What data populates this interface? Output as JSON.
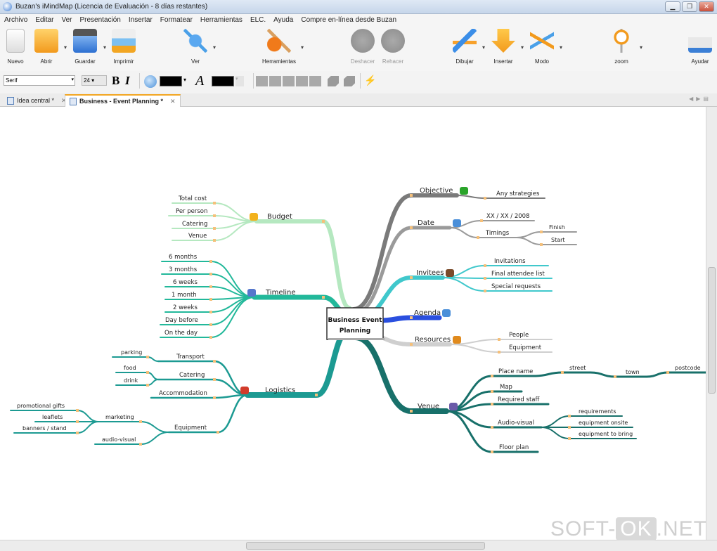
{
  "window": {
    "title": "Buzan's iMindMap (Licencia de Evaluación -   8 días restantes)"
  },
  "menu": [
    "Archivo",
    "Editar",
    "Ver",
    "Presentación",
    "Insertar",
    "Formatear",
    "Herramientas",
    "ELC.",
    "Ayuda",
    "Compre en-línea desde Buzan"
  ],
  "toolbar": {
    "nuevo": "Nuevo",
    "abrir": "Abrir",
    "guardar": "Guardar",
    "imprimir": "Imprimir",
    "ver": "Ver",
    "herramientas": "Herramientas",
    "deshacer": "Deshacer",
    "rehacer": "Rehacer",
    "dibujar": "Dibujar",
    "insertar": "Insertar",
    "modo": "Modo",
    "zoom": "zoom",
    "ayudar": "Ayudar"
  },
  "format": {
    "font": "Serif",
    "size": "24",
    "bold": "B",
    "italic": "I",
    "text_icon": "A",
    "fill_color": "#000000",
    "text_color": "#000000"
  },
  "tabs": [
    {
      "label": "Idea central *",
      "active": false
    },
    {
      "label": "Business - Event Planning *",
      "active": true
    }
  ],
  "mindmap": {
    "center": [
      "Business Event",
      "Planning"
    ],
    "branches": [
      {
        "label": "Budget",
        "icon": "coins-icon",
        "color": "#b5e8c0",
        "children": [
          {
            "label": "Total cost"
          },
          {
            "label": "Per person"
          },
          {
            "label": "Catering"
          },
          {
            "label": "Venue"
          }
        ]
      },
      {
        "label": "Timeline",
        "icon": "chart-icon",
        "color": "#22b89a",
        "children": [
          {
            "label": "6 months"
          },
          {
            "label": "3 months"
          },
          {
            "label": "6 weeks"
          },
          {
            "label": "1 month"
          },
          {
            "label": "2 weeks"
          },
          {
            "label": "Day before"
          },
          {
            "label": "On the day"
          }
        ]
      },
      {
        "label": "Logistics",
        "icon": "truck-icon",
        "color": "#1c9a92",
        "children": [
          {
            "label": "Transport",
            "children": [
              {
                "label": "parking"
              }
            ]
          },
          {
            "label": "Catering",
            "children": [
              {
                "label": "food"
              },
              {
                "label": "drink"
              }
            ]
          },
          {
            "label": "Accommodation"
          },
          {
            "label": "Equipment",
            "children": [
              {
                "label": "marketing",
                "children": [
                  {
                    "label": "promotional gifts"
                  },
                  {
                    "label": "leaflets"
                  },
                  {
                    "label": "banners / stand"
                  }
                ]
              },
              {
                "label": "audio-visual"
              }
            ]
          }
        ]
      },
      {
        "label": "Objective",
        "icon": "arrow-icon",
        "color": "#7a7a7a",
        "children": [
          {
            "label": "Any strategies"
          }
        ]
      },
      {
        "label": "Date",
        "icon": "calendar-icon",
        "color": "#9a9a9a",
        "children": [
          {
            "label": "XX / XX / 2008"
          },
          {
            "label": "Timings",
            "children": [
              {
                "label": "Finish"
              },
              {
                "label": "Start"
              }
            ]
          }
        ]
      },
      {
        "label": "Invitees",
        "icon": "people-icon",
        "color": "#40c8cc",
        "children": [
          {
            "label": "Invitations"
          },
          {
            "label": "Final attendee list"
          },
          {
            "label": "Special requests"
          }
        ]
      },
      {
        "label": "Agenda",
        "icon": "clock-icon",
        "color": "#2a4fdf",
        "children": []
      },
      {
        "label": "Resources",
        "icon": "tools-icon",
        "color": "#cfcfcf",
        "children": [
          {
            "label": "People"
          },
          {
            "label": "Equipment"
          }
        ]
      },
      {
        "label": "Venue",
        "icon": "house-icon",
        "color": "#18706a",
        "children": [
          {
            "label": "Place name",
            "children": [
              {
                "label": "street",
                "children": [
                  {
                    "label": "town",
                    "children": [
                      {
                        "label": "postcode"
                      }
                    ]
                  }
                ]
              }
            ]
          },
          {
            "label": "Map"
          },
          {
            "label": "Required staff"
          },
          {
            "label": "Audio-visual",
            "children": [
              {
                "label": "requirements"
              },
              {
                "label": "equipment onsite"
              },
              {
                "label": "equipment to bring"
              }
            ]
          },
          {
            "label": "Floor plan"
          }
        ]
      }
    ]
  },
  "watermark": {
    "left": "SOFT-",
    "ok": "OK",
    ".net": ".NET"
  }
}
